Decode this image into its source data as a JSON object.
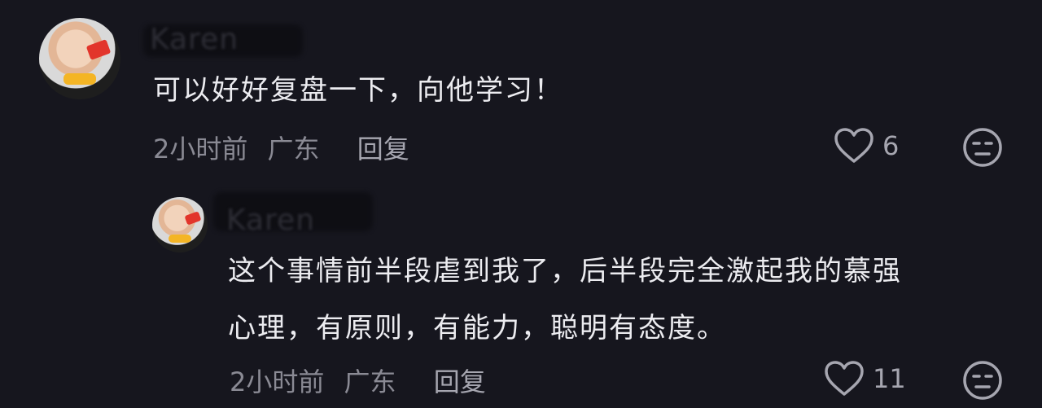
{
  "comments": [
    {
      "username": "Karen",
      "text": "可以好好复盘一下，向他学习！",
      "time": "2小时前",
      "location": "广东",
      "reply_label": "回复",
      "likes": "6"
    },
    {
      "username": "Karen",
      "text_line1": "这个事情前半段虐到我了，后半段完全激起我的慕强",
      "text_line2": "心理，有原则，有能力，聪明有态度。",
      "time": "2小时前",
      "location": "广东",
      "reply_label": "回复",
      "likes": "11"
    }
  ],
  "icons": {
    "like": "heart-outline-icon",
    "emoji": "neutral-face-icon"
  }
}
